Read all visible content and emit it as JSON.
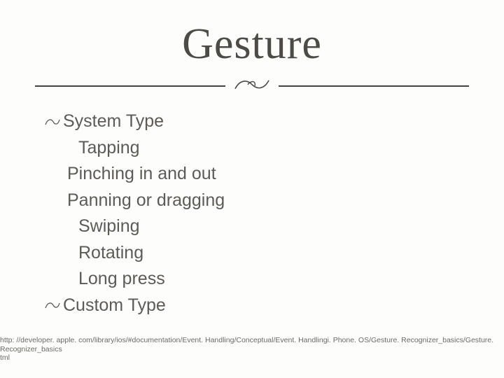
{
  "title": "Gesture",
  "bullets": {
    "system": "System Type",
    "custom": "Custom Type"
  },
  "subs": {
    "tapping": "Tapping",
    "pinching": "Pinching in and out",
    "panning": "Panning or dragging",
    "swiping": "Swiping",
    "rotating": "Rotating",
    "longpress": "Long press"
  },
  "footnote": {
    "line1": "http: //developer. apple. com/library/ios/#documentation/Event. Handling/Conceptual/Event. Handlingi. Phone. OS/Gesture. Recognizer_basics/Gesture. Recognizer_basics",
    "line2": "tml"
  }
}
